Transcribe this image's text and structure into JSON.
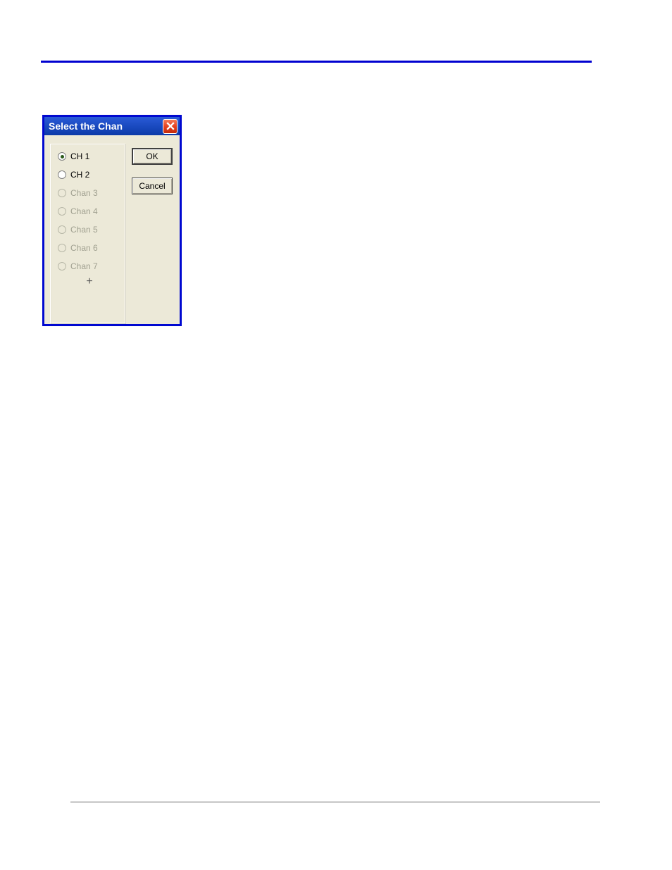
{
  "dialog": {
    "title": "Select the Chan",
    "radios": [
      {
        "label": "CH 1",
        "selected": true,
        "enabled": true
      },
      {
        "label": "CH 2",
        "selected": false,
        "enabled": true
      },
      {
        "label": "Chan 3",
        "selected": false,
        "enabled": false
      },
      {
        "label": "Chan 4",
        "selected": false,
        "enabled": false
      },
      {
        "label": "Chan 5",
        "selected": false,
        "enabled": false
      },
      {
        "label": "Chan 6",
        "selected": false,
        "enabled": false
      },
      {
        "label": "Chan 7",
        "selected": false,
        "enabled": false
      }
    ],
    "buttons": {
      "ok": "OK",
      "cancel": "Cancel"
    }
  }
}
